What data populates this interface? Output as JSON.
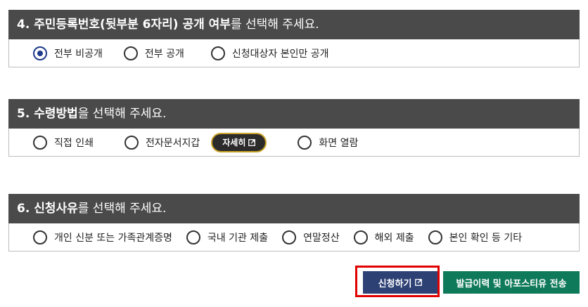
{
  "sections": [
    {
      "heading_bold": "4. 주민등록번호(뒷부분 6자리) 공개 여부",
      "heading_rest": "를 선택해 주세요.",
      "options": [
        "전부 비공개",
        "전부 공개",
        "신청대상자 본인만 공개"
      ],
      "selected": "전부 비공개"
    },
    {
      "heading_bold": "5. 수령방법",
      "heading_rest": "을 선택해 주세요.",
      "options": [
        "직접 인쇄",
        "전자문서지갑",
        "화면 열람"
      ],
      "detail_button": "자세히"
    },
    {
      "heading_bold": "6. 신청사유",
      "heading_rest": "를 선택해 주세요.",
      "options": [
        "개인 신분 또는 가족관계증명",
        "국내 기관 제출",
        "연말정산",
        "해외 제출",
        "본인 확인 등 기타"
      ]
    }
  ],
  "buttons": {
    "apply": "신청하기",
    "history": "발급이력 및 아포스티유 전송"
  },
  "colors": {
    "header_bg": "#4a4a4a",
    "apply_bg": "#2e4175",
    "history_bg": "#0f7a5a",
    "highlight": "#e00000"
  }
}
